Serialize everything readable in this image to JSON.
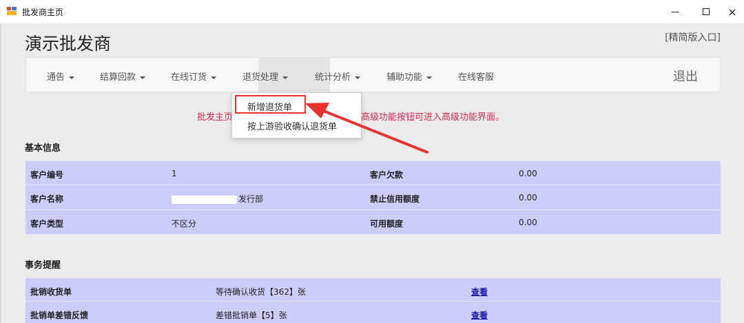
{
  "window": {
    "title": "批发商主页",
    "icon": "app-icon",
    "controls": {
      "minimize": "minimize-icon",
      "maximize": "maximize-icon",
      "close": "×"
    }
  },
  "header": {
    "company": "演示批发商",
    "simple_link": "[精简版入口]"
  },
  "nav": {
    "items": [
      {
        "label": "通告"
      },
      {
        "label": "结算回款"
      },
      {
        "label": "在线订货"
      },
      {
        "label": "退货处理"
      },
      {
        "label": "统计分析"
      },
      {
        "label": "辅助功能"
      },
      {
        "label": "在线客服"
      }
    ],
    "logout": "退出",
    "active_index": 3
  },
  "dropdown": {
    "items": [
      {
        "label": "新增退货单"
      },
      {
        "label": "按上游验收确认退货单"
      }
    ]
  },
  "notice": {
    "visible_prefix": "批发主页",
    "visible_suffix": "击高级功能按钮可进入高级功能界面。"
  },
  "basic_info": {
    "title": "基本信息",
    "rows": [
      {
        "label1": "客户编号",
        "value1": "1",
        "label2": "客户欠款",
        "value2": "0.00"
      },
      {
        "label1": "客户名称",
        "value1": "发行部",
        "label2": "禁止信用额度",
        "value2": "0.00"
      },
      {
        "label1": "客户类型",
        "value1": "不区分",
        "label2": "可用额度",
        "value2": "0.00"
      }
    ]
  },
  "tasks": {
    "title": "事务提醒",
    "rows": [
      {
        "name": "批销收货单",
        "desc": "等待确认收货【362】张",
        "link": "查看"
      },
      {
        "name": "批销单差错反馈",
        "desc": "差错批销单【5】张",
        "link": "查看"
      }
    ]
  },
  "colors": {
    "row_bg": "#cdcdfb",
    "notice": "#d62a48",
    "highlight": "#e8332f",
    "link": "#1a1aa8"
  }
}
